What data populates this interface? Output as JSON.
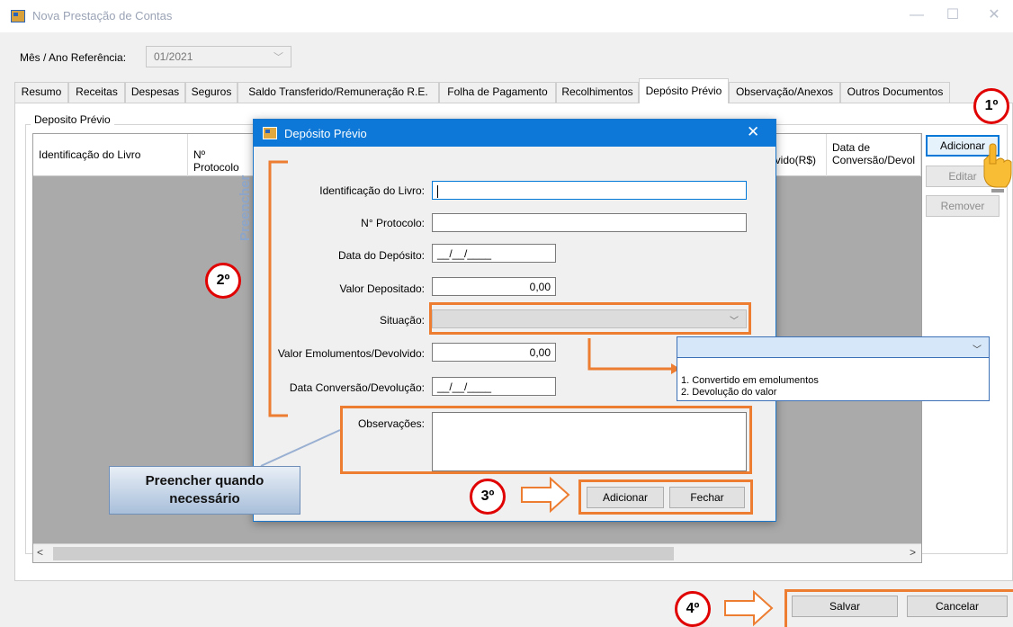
{
  "window": {
    "title": "Nova Prestação de Contas",
    "minimize_glyph": "—",
    "maximize_glyph": "☐",
    "close_glyph": "✕"
  },
  "reference": {
    "label": "Mês / Ano Referência:",
    "value": "01/2021"
  },
  "tabs": [
    {
      "label": "Resumo"
    },
    {
      "label": "Receitas"
    },
    {
      "label": "Despesas"
    },
    {
      "label": "Seguros"
    },
    {
      "label": "Saldo Transferido/Remuneração R.E."
    },
    {
      "label": "Folha de Pagamento"
    },
    {
      "label": "Recolhimentos"
    },
    {
      "label": "Depósito Prévio",
      "active": true
    },
    {
      "label": "Observação/Anexos"
    },
    {
      "label": "Outros Documentos"
    }
  ],
  "group": {
    "label": "Deposito Prévio"
  },
  "grid": {
    "columns": [
      {
        "label": "Identificação do Livro"
      },
      {
        "label": "Nº Protocolo"
      },
      {
        "label": "lvido(R$)"
      },
      {
        "label": "Data de Conversão/Devol"
      }
    ],
    "scroll_left": "<",
    "scroll_right": ">"
  },
  "side_buttons": {
    "add": "Adicionar",
    "edit": "Editar",
    "remove": "Remover"
  },
  "footer": {
    "save": "Salvar",
    "cancel": "Cancelar"
  },
  "dialog": {
    "title": "Depósito Prévio",
    "close_glyph": "✕",
    "fields": {
      "livro_label": "Identificação do Livro:",
      "protocolo_label": "N° Protocolo:",
      "data_deposito_label": "Data do Depósito:",
      "data_deposito_value": "__/__/____",
      "valor_depositado_label": "Valor Depositado:",
      "valor_depositado_value": "0,00",
      "situacao_label": "Situação:",
      "valor_emolumentos_label": "Valor Emolumentos/Devolvido:",
      "valor_emolumentos_value": "0,00",
      "data_conversao_label": "Data Conversão/Devolução:",
      "data_conversao_value": "__/__/____",
      "observacoes_label": "Observações:"
    },
    "buttons": {
      "add": "Adicionar",
      "close": "Fechar"
    }
  },
  "situacao_dropdown": {
    "options": [
      "1. Convertido em emolumentos",
      "2. Devolução do valor"
    ]
  },
  "annotations": {
    "step1": "1º",
    "step2": "2º",
    "step3": "3º",
    "step4": "4º",
    "preencher": "Preencher",
    "callout": "Preencher quando necessário",
    "accent_color": "#ed7d31",
    "badge_color": "#e00000"
  }
}
